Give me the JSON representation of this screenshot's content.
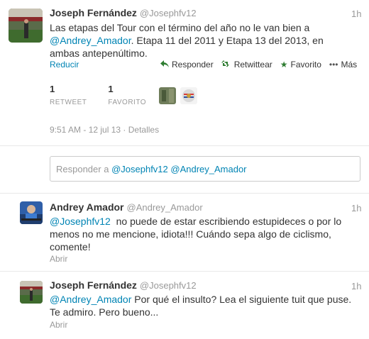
{
  "main_tweet": {
    "name": "Joseph Fernández",
    "handle": "@Josephfv12",
    "time": "1h",
    "text_line1": "Las etapas del Tour con el término del año no le van bien a",
    "text_mention": "@Andrey_Amador",
    "text_line2_rest": ". Etapa 11 del 2011 y Etapa 13 del 2013, en",
    "text_line3": "ambas antepenúltimo.",
    "collapse": "Reducir",
    "actions": {
      "reply": "Responder",
      "retweet": "Retwittear",
      "favorite": "Favorito",
      "more": "Más"
    },
    "retweets_count": "1",
    "retweets_label": "RETWEET",
    "favorites_count": "1",
    "favorites_label": "FAVORITO",
    "timestamp": "9:51 AM - 12 jul 13",
    "details": "Detalles"
  },
  "reply_box": {
    "prefix": "Responder a",
    "mentions": "@Josephfv12 @Andrey_Amador"
  },
  "replies": [
    {
      "name": "Andrey Amador",
      "handle": "@Andrey_Amador",
      "time": "1h",
      "mention": "@Josephfv12",
      "line1_rest": "  no puede de estar escribiendo estupideces o por lo",
      "line2": "menos no me mencione, idiota!!! Cuándo sepa algo de ciclismo,",
      "line3": "comente!",
      "open": "Abrir"
    },
    {
      "name": "Joseph Fernández",
      "handle": "@Josephfv12",
      "time": "1h",
      "mention": "@Andrey_Amador",
      "line1_rest": " Por qué el insulto? Lea el siguiente tuit que puse.",
      "line2": "Te admiro. Pero bueno...",
      "open": "Abrir"
    }
  ],
  "colors": {
    "link": "#0084b4",
    "muted": "#999999",
    "text": "#333333"
  },
  "icons": [
    "reply-icon",
    "retweet-icon",
    "favorite-star-icon",
    "more-dots-icon"
  ]
}
